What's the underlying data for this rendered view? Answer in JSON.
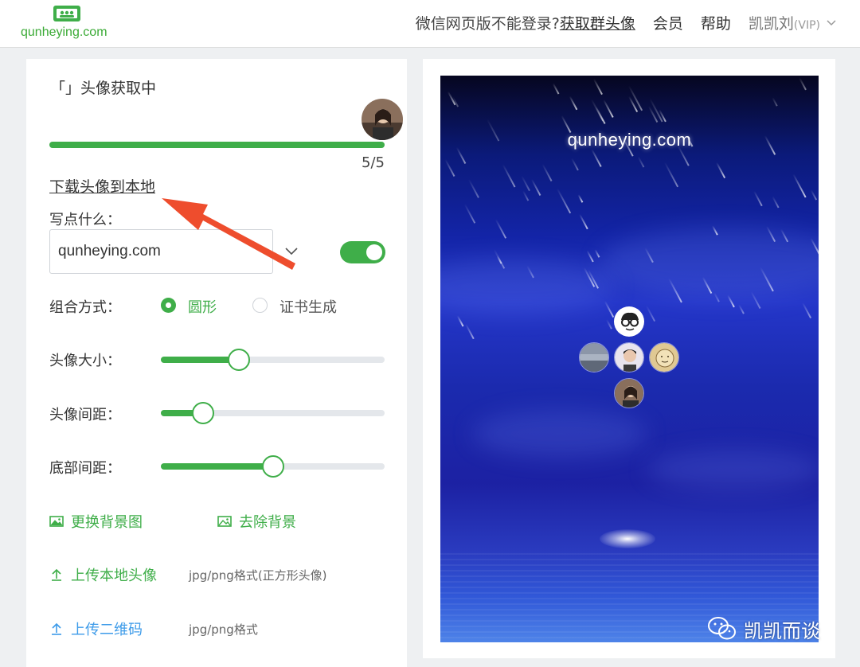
{
  "header": {
    "logo_text": "qunheying.com",
    "question": "微信网页版不能登录?",
    "get_avatar_link": "获取群头像",
    "member": "会员",
    "help": "帮助",
    "user_name": "凯凯刘",
    "user_vip": "(VIP)"
  },
  "left": {
    "status": "「」头像获取中",
    "progress": {
      "count": "5/5",
      "fraction": 1.0
    },
    "download_link": "下载头像到本地",
    "write_label": "写点什么：",
    "text_value": "qunheying.com",
    "toggle_on": true,
    "combine_label": "组合方式：",
    "combine_options": [
      {
        "label": "圆形",
        "selected": true
      },
      {
        "label": "证书生成",
        "selected": false
      }
    ],
    "sliders": [
      {
        "label": "头像大小：",
        "value": 0.35
      },
      {
        "label": "头像间距：",
        "value": 0.19
      },
      {
        "label": "底部间距：",
        "value": 0.5
      }
    ],
    "change_bg": "更换背景图",
    "remove_bg": "去除背景",
    "upload_avatar": "上传本地头像",
    "upload_avatar_hint": "jpg/png格式(正方形头像)",
    "upload_qr": "上传二维码",
    "upload_qr_hint": "jpg/png格式"
  },
  "preview": {
    "text": "qunheying.com"
  },
  "watermark": "凯凯而谈",
  "colors": {
    "accent": "#3fae49",
    "link_blue": "#3d9be9"
  }
}
